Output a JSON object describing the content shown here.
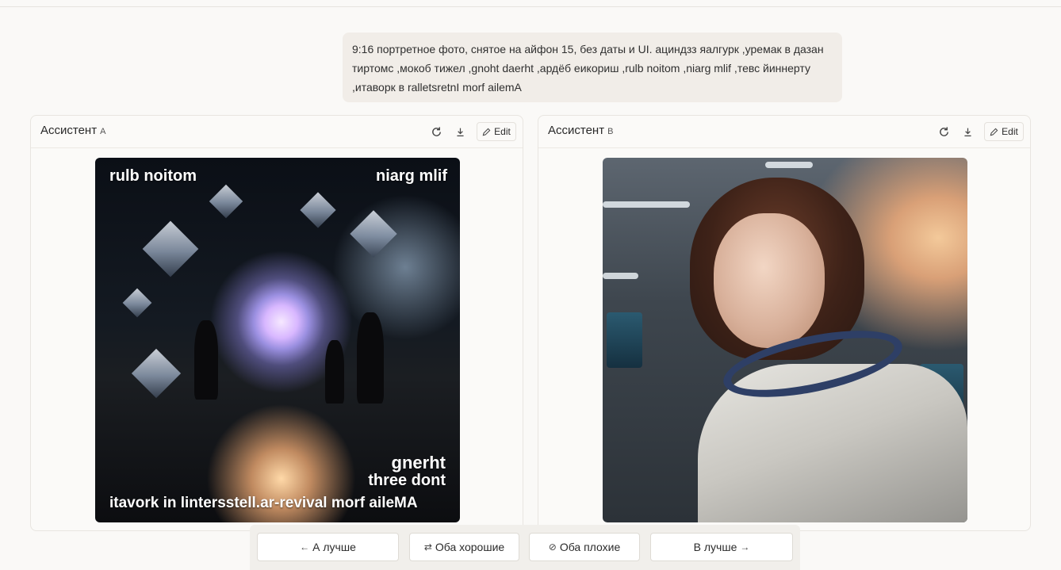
{
  "prompt": {
    "text": "9:16 портретное фото, снятое на айфон 15, без даты и UI. ацин­дз­з яалгурк ,уремак в дазан тиртомс ,мокоб тижел ,gnoht daerht ,ардёб еикориш ,rulb noitom ,niarg mlif ,тевс йиннерту ,итаворк в ralletsretnI morf ailemA"
  },
  "panels": [
    {
      "title": "Ассистент",
      "tag": "A",
      "edit_label": "Edit",
      "icons": [
        "refresh-icon",
        "download-icon",
        "pencil-icon"
      ],
      "image_text": {
        "top_left": "rulb noitom",
        "top_right": "niarg mlif",
        "bottom_line1": "gnerht",
        "bottom_line2": "three dont",
        "bottom_line3": "itavork in lintersstell.ar-revival morf aileMA"
      }
    },
    {
      "title": "Ассистент",
      "tag": "B",
      "edit_label": "Edit",
      "icons": [
        "refresh-icon",
        "download-icon",
        "pencil-icon"
      ]
    }
  ],
  "votes": {
    "a_better": "А лучше",
    "both_good": "Оба хорошие",
    "both_bad": "Оба плохие",
    "b_better": "В лучше"
  }
}
